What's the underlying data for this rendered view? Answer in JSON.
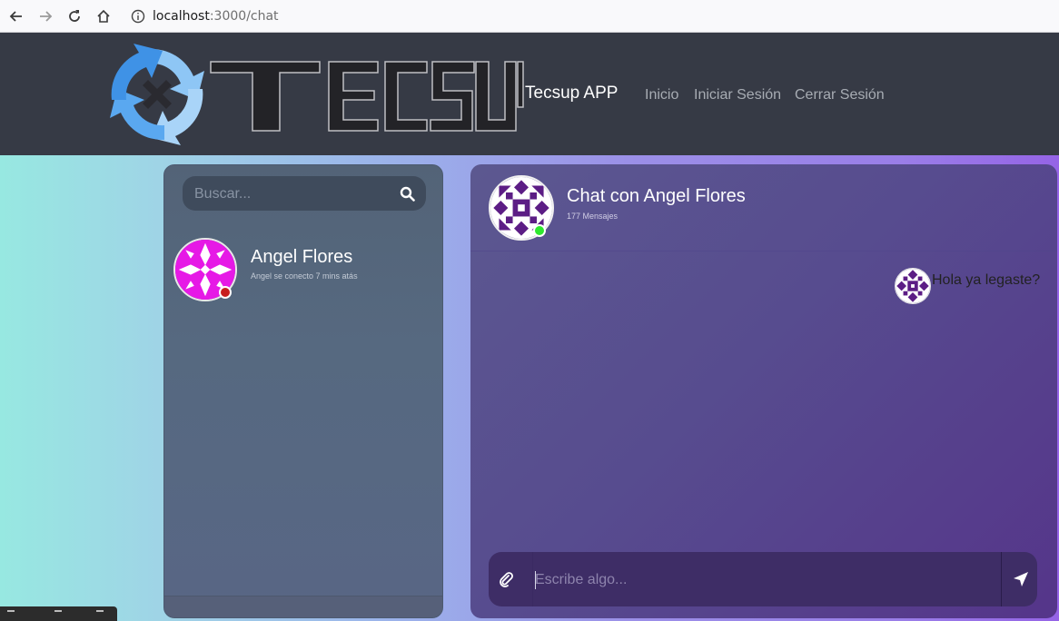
{
  "browser": {
    "url_host": "localhost",
    "url_path": ":3000/chat",
    "icons": [
      "back-icon",
      "forward-icon",
      "reload-icon",
      "home-icon",
      "info-icon"
    ]
  },
  "header": {
    "logo_text": "TECSUP",
    "brand": "Tecsup APP",
    "nav": [
      "Inicio",
      "Iniciar Sesión",
      "Cerrar Sesión"
    ]
  },
  "sidebar": {
    "search_placeholder": "Buscar...",
    "contacts": [
      {
        "name": "Angel Flores",
        "status_text": "Angel se conecto 7 mins atás",
        "status": "offline",
        "status_color": "#c81e1e"
      }
    ]
  },
  "chat": {
    "title": "Chat con Angel Flores",
    "message_count": "177 Mensajes",
    "status": "online",
    "status_color": "#2ee82e",
    "messages": [
      {
        "text": "Hola ya legaste?"
      }
    ],
    "composer_placeholder": "Escribe algo..."
  },
  "colors": {
    "header_bg": "#363a45",
    "accent_blue": "#5aa8f0",
    "avatar_magenta": "#e619e6",
    "avatar_purple": "#5c1d85"
  }
}
